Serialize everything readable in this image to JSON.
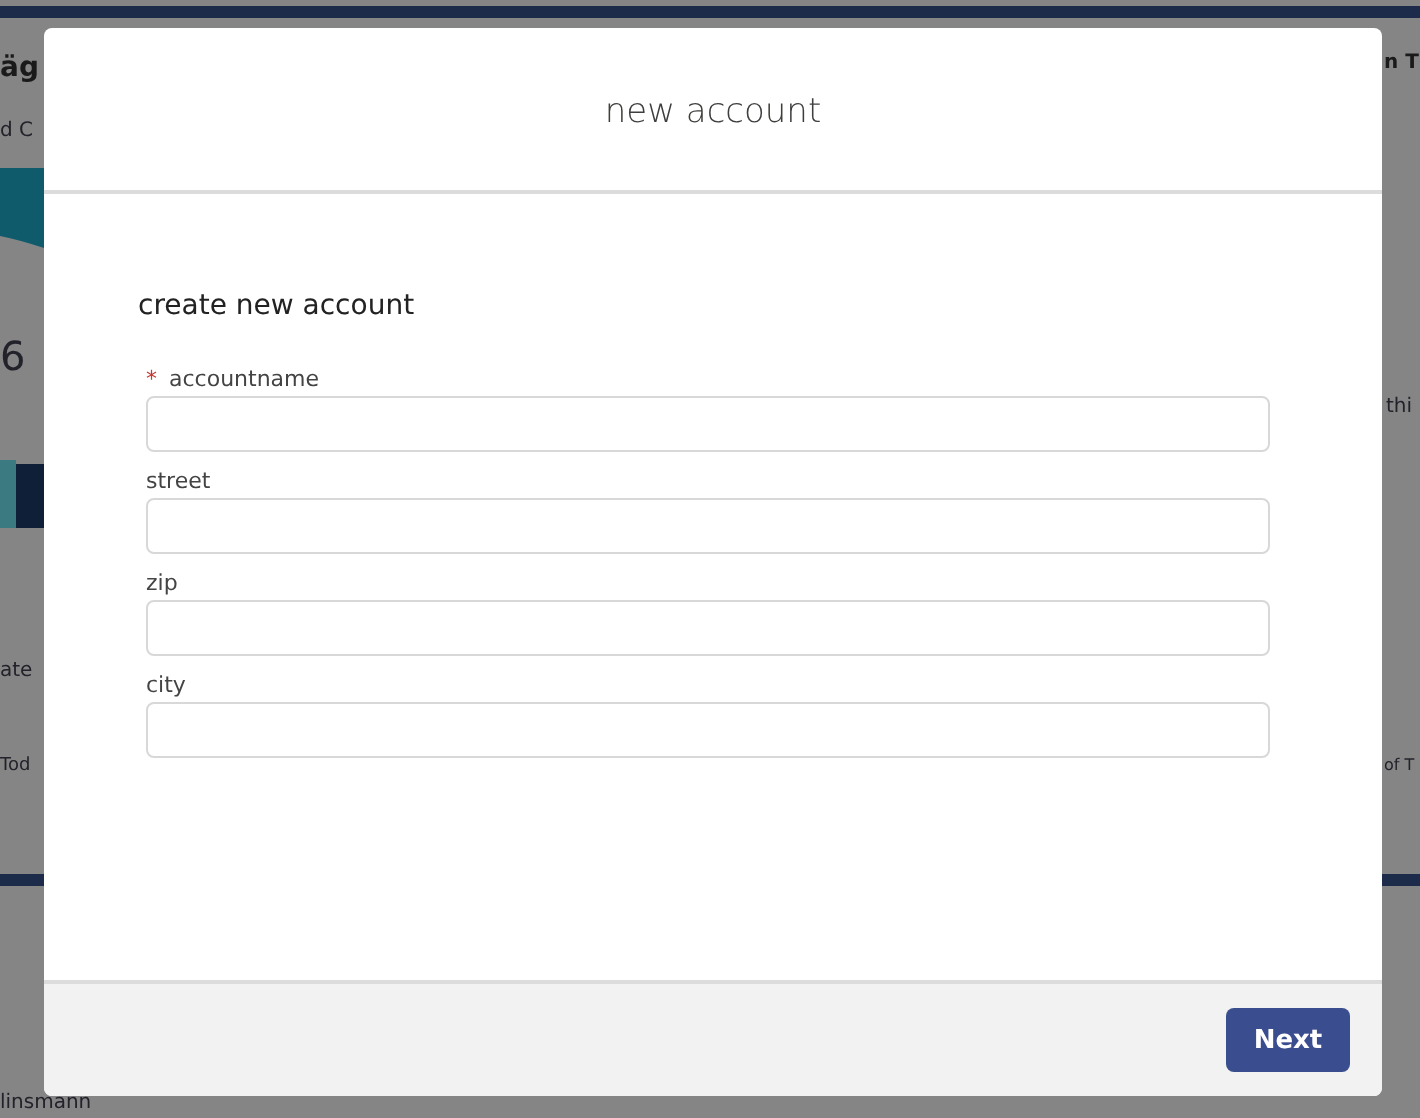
{
  "background": {
    "fragments": [
      "äg",
      "d C",
      "6",
      "ate",
      "Tod",
      "linsmann",
      "n T",
      "thi",
      "of T"
    ]
  },
  "modal": {
    "title": "new account",
    "heading": "create new account",
    "required_mark": "*",
    "fields": [
      {
        "label": "accountname",
        "required": true
      },
      {
        "label": "street",
        "required": false
      },
      {
        "label": "zip",
        "required": false
      },
      {
        "label": "city",
        "required": false
      }
    ],
    "buttons": [
      "Next"
    ]
  }
}
